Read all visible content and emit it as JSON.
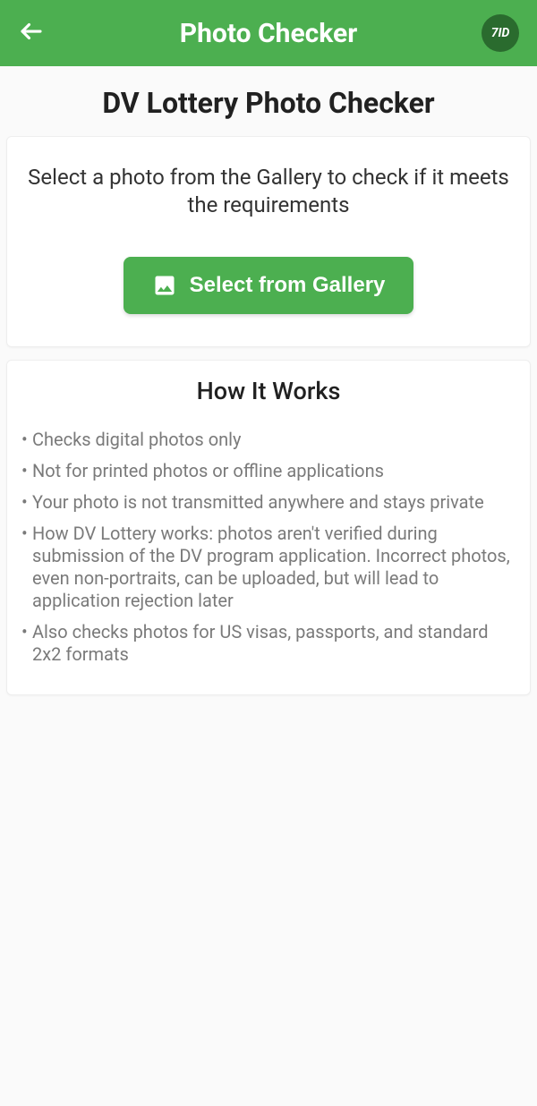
{
  "header": {
    "title": "Photo Checker",
    "logo_text": "7ID"
  },
  "page_title": "DV Lottery Photo Checker",
  "select_card": {
    "instruction": "Select a photo from the Gallery to check if it meets the requirements",
    "button_label": "Select from Gallery"
  },
  "how_it_works": {
    "title": "How It Works",
    "items": [
      "Checks digital photos only",
      "Not for printed photos or offline applications",
      "Your photo is not transmitted anywhere and stays private",
      "How DV Lottery works: photos aren't verified during submission of the DV program application. Incorrect photos, even non-portraits, can be uploaded, but will lead to application rejection later",
      "Also checks photos for US visas, passports, and standard 2x2 formats"
    ]
  }
}
